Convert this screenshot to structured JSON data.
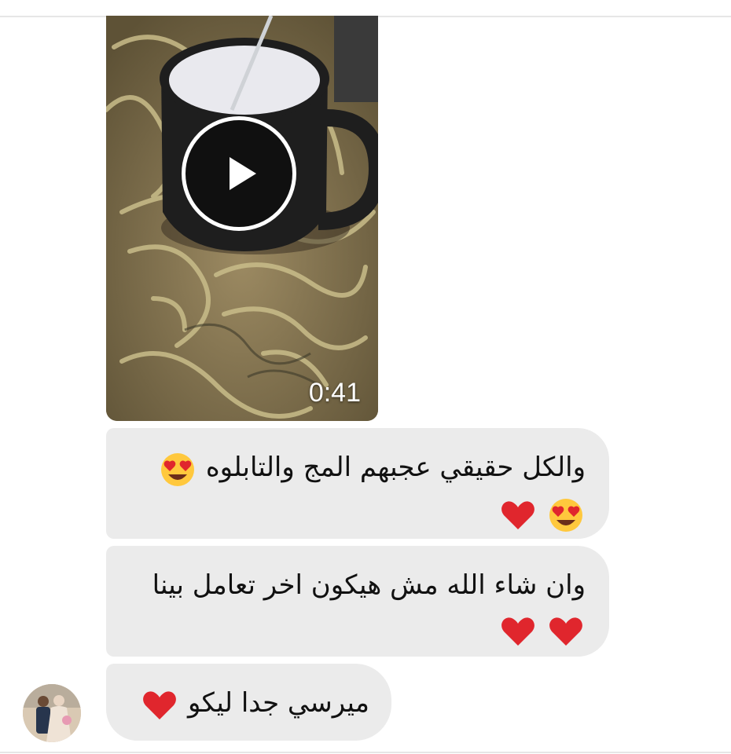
{
  "video": {
    "duration": "0:41",
    "play_icon": "play-icon"
  },
  "messages": [
    {
      "text": "والكل حقيقي عجبهم المج والتابلوه",
      "emoji": [
        "heart-eyes-icon",
        "heart-eyes-icon",
        "heart-icon"
      ]
    },
    {
      "text": "وان شاء الله مش هيكون اخر تعامل بينا",
      "emoji": [
        "heart-icon",
        "heart-icon"
      ]
    },
    {
      "text": "ميرسي جدا ليكو",
      "emoji": [
        "heart-icon"
      ]
    }
  ],
  "colors": {
    "bubble": "#ebebeb",
    "text": "#111111",
    "heart": "#e0262d",
    "emoji_face": "#ffc83d"
  }
}
